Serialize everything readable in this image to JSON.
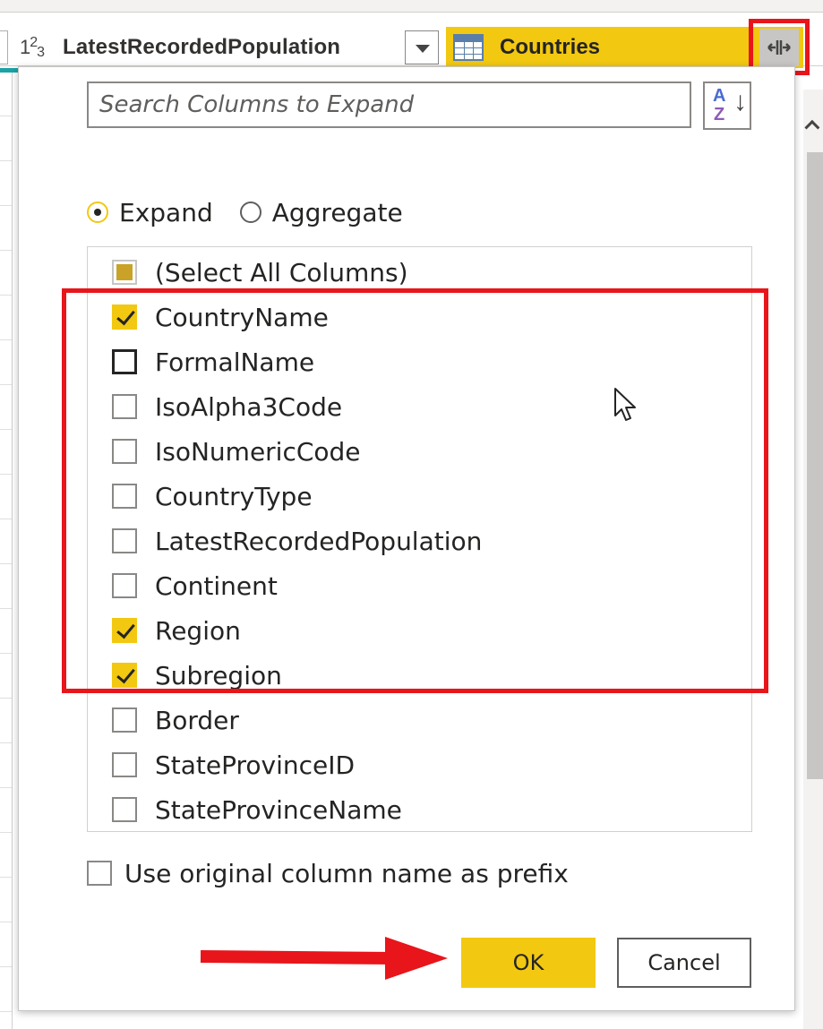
{
  "header": {
    "column_type_glyph": "1²3",
    "column_latest_name": "LatestRecordedPopulation",
    "column_countries_name": "Countries"
  },
  "dialog": {
    "search_placeholder": "Search Columns to Expand",
    "sort_icon_top": "A",
    "sort_icon_bottom": "Z",
    "sort_icon_arrow": "↓",
    "radio_expand": "Expand",
    "radio_aggregate": "Aggregate",
    "selected_mode": "Expand",
    "select_all_label": "(Select All Columns)",
    "columns": [
      {
        "label": "CountryName",
        "checked": true
      },
      {
        "label": "FormalName",
        "checked": false
      },
      {
        "label": "IsoAlpha3Code",
        "checked": false
      },
      {
        "label": "IsoNumericCode",
        "checked": false
      },
      {
        "label": "CountryType",
        "checked": false
      },
      {
        "label": "LatestRecordedPopulation",
        "checked": false
      },
      {
        "label": "Continent",
        "checked": false
      },
      {
        "label": "Region",
        "checked": true
      },
      {
        "label": "Subregion",
        "checked": true
      },
      {
        "label": "Border",
        "checked": false
      },
      {
        "label": "StateProvinceID",
        "checked": false
      },
      {
        "label": "StateProvinceName",
        "checked": false
      }
    ],
    "prefix_label": "Use original column name as prefix",
    "prefix_checked": false,
    "ok_label": "OK",
    "cancel_label": "Cancel"
  },
  "icons": {
    "expand_column": "expand-columns-icon",
    "table": "table-icon",
    "sort": "sort-az-icon",
    "cursor": "mouse-pointer-icon"
  },
  "colors": {
    "accent": "#f2c811",
    "highlight": "#e8151b",
    "teal": "#1ba3a6"
  }
}
